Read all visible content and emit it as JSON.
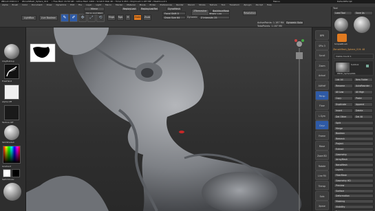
{
  "titlebar": {
    "app": "ZBrush 2022.0.1",
    "doc": "ZbrushMesh_Sphere_019",
    "stats": "• Free Mem 24.59 GB • Active Mem 1469 • Scratch Disk 46 • Timer 0.453 • PolyCount 1.187 MP • MeshCount 1",
    "menus": "Menus",
    "defaultscript": "DefaultZScript"
  },
  "menubar": [
    "Alpha",
    "Brush",
    "Color",
    "Document",
    "Draw",
    "Dynamics",
    "Edit",
    "File",
    "Layer",
    "Light",
    "Macro",
    "Marker",
    "Material",
    "Movie",
    "Picker",
    "Preferences",
    "Render",
    "Stencil",
    "Stroke",
    "Texture",
    "Tool",
    "Transform",
    "Zplugin",
    "Zscript",
    "Help"
  ],
  "shelf": {
    "lightbox": "LightBox",
    "live_boolean": "Live Boolean",
    "edit": "Edit",
    "draw": "Draw",
    "move": "Move",
    "scale": "Scale",
    "rotate": "Rotate",
    "mrgb": "Mrgb",
    "rgb": "Rgb",
    "m": "M",
    "zadd": "Zadd",
    "zsub": "Zsub",
    "zcut": "Zcut",
    "focal_shift": "Focal Shift 0",
    "draw_size": "Draw Size 64",
    "dynamic": "Dynamic",
    "rgb_intensity": "Rgb Intensity 100",
    "z_intensity": "Z Intensity 25",
    "mirror": "Mirror",
    "mirror_and_weld": "Mirror And Weld",
    "replay_last": "ReplayLast",
    "replay_last_rel": "ReplayLastRel",
    "dynamesh": "DynaMesh",
    "resolution": "Resolution 256",
    "zremesher": "ZRemesher",
    "target_polygons": "Target Polygons Count 5",
    "adapt": "Adapt",
    "backface": "BackfaceMask",
    "active_points": "ActivePoints: 1.187 Mil",
    "total_points": "TotalPoints: 1.187 Mil",
    "dynamic_subdiv": "Dynamic Subdiv",
    "spix": "SPix 3",
    "scroll": "Scroll",
    "zoom": "Zoom",
    "actual": "Actual",
    "aahalf": "AAHalf",
    "persp": "Persp",
    "floor": "Floor",
    "local": "Local",
    "frame": "Frame",
    "move2": "Move",
    "zoom3d": "Zoom3D",
    "rotate2": "Rotate",
    "polyf": "PolyF",
    "transp": "Transp",
    "ghost": "Ghost",
    "solo": "Solo",
    "xpose": "Xpose",
    "mrgb2": "Mrgb",
    "autosave_label": "QuickSave",
    "see_through": "See-through 0",
    "menus_btn": "Menus",
    "default_zscript": "DefaultZScript"
  },
  "left": {
    "standard": "ClayBuildup",
    "dots": "FreeHand",
    "alpha_off": "Alpha Off",
    "texture_off": "Texture Off",
    "material": "SkinShade4",
    "gradient": "Gradient",
    "switch_color": "SwitchColor",
    "alternate": "Alternate"
  },
  "right_panel": {
    "tool_header": "Tool",
    "load_tool": "Load Tool",
    "save_as": "Save As",
    "copy_tool": "Copy Tool",
    "paste_tool": "Paste Tool",
    "import": "Import",
    "export": "Export",
    "clone": "Clone",
    "make_polymesh": "Make PolyMesh3D",
    "goz": "GoZ",
    "all": "All",
    "visible": "Visible",
    "r": "R",
    "lightbox_tools": "Lightbox▸Tools",
    "current_tool": "ZbrushMesh_Sphere_019: 48",
    "tool_thumb1": "PolyMesh3D",
    "tool_thumb2": "SimpleBrush",
    "tool_thumb3": "Sphere3D",
    "tool_thumb4": "ZSphere",
    "subtool": "Subtool",
    "visible_count": "Visible Count 1",
    "v1": "V1",
    "subtool_item": "PM3D_Sphere3D1",
    "list_all": "List All",
    "new_folder": "New Folder",
    "rename": "Rename",
    "auto_reorder": "AutoReorder",
    "all_low": "All Low",
    "all_high": "All High",
    "copy": "Copy",
    "paste": "Paste",
    "duplicate": "Duplicate",
    "append": "Append",
    "insert": "Insert",
    "delete": "Delete",
    "del_other": "Del Other",
    "del_all": "Del All",
    "split": "Split",
    "merge": "Merge",
    "boolean": "Boolean",
    "remesh": "Remesh",
    "project": "Project",
    "extract": "Extract",
    "geometry": "Geometry",
    "array_mesh": "ArrayMesh",
    "nano_mesh": "NanoMesh",
    "layers": "Layers",
    "fiber_mesh": "FiberMesh",
    "geometry_hd": "Geometry HD",
    "preview": "Preview",
    "surface": "Surface",
    "deformation": "Deformation",
    "masking": "Masking",
    "visibility": "Visibility",
    "polygroups": "Polygroups"
  },
  "right_shelf": {
    "bpr": "BPR",
    "spix": "SPix 3",
    "scroll": "Scroll",
    "zoom": "Zoom",
    "actual": "Actual",
    "aahalf": "AAHalf",
    "persp": "Persp",
    "floor": "Floor",
    "lsym": "L.Sym",
    "xyz": "Gxyz",
    "frame": "Frame",
    "move": "Move",
    "zoom3d": "Zoom3D",
    "rotate": "Rotate",
    "line_fill": "Line Fill PolyF",
    "transp": "Transp",
    "solo": "Solo",
    "xpose": "Xpose"
  },
  "colors": {
    "accent": "#e07a20",
    "selected": "#2e5aa6",
    "red": "#c82828"
  }
}
